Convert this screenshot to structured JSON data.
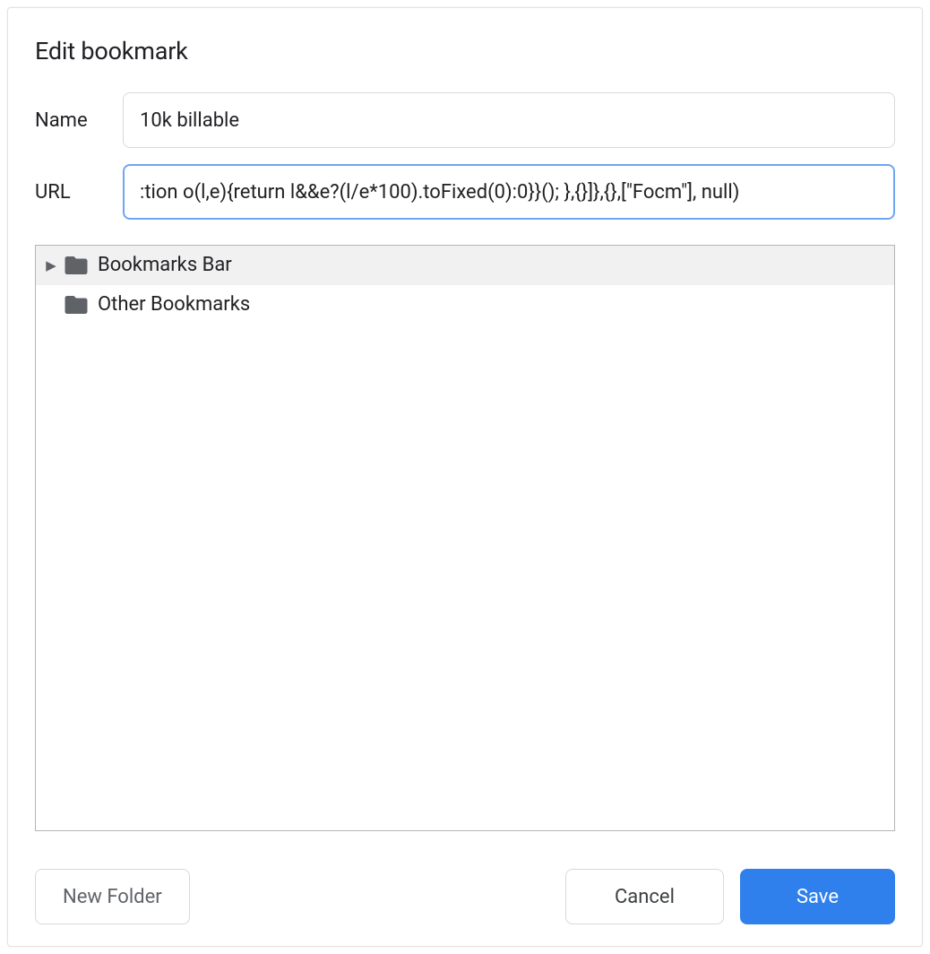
{
  "dialog": {
    "title": "Edit bookmark",
    "name_label": "Name",
    "url_label": "URL",
    "name_value": "10k billable",
    "url_value": ":tion o(l,e){return l&&e?(l/e*100).toFixed(0):0}}(); },{}]},{},[\"Focm\"], null)"
  },
  "tree": {
    "items": [
      {
        "label": "Bookmarks Bar",
        "selected": true,
        "expandable": true
      },
      {
        "label": "Other Bookmarks",
        "selected": false,
        "expandable": false
      }
    ]
  },
  "buttons": {
    "new_folder": "New Folder",
    "cancel": "Cancel",
    "save": "Save"
  }
}
